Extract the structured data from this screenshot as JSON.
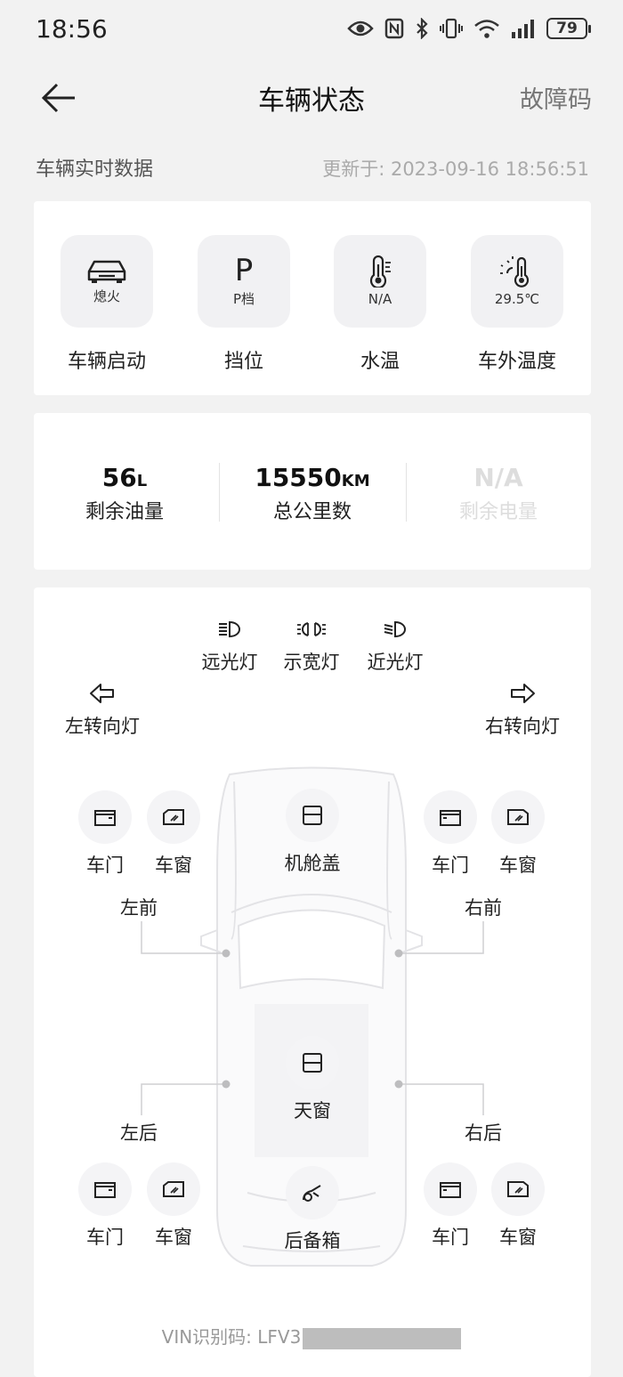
{
  "status_bar": {
    "time": "18:56",
    "battery": "79",
    "icons": [
      "eye-icon",
      "nfc-icon",
      "bluetooth-icon",
      "vibrate-icon",
      "wifi-icon",
      "signal-icon",
      "battery-icon"
    ]
  },
  "header": {
    "title": "车辆状态",
    "action": "故障码"
  },
  "realtime": {
    "label": "车辆实时数据",
    "updated": "更新于:  2023-09-16 18:56:51"
  },
  "status_tiles": [
    {
      "value": "熄火",
      "label": "车辆启动",
      "icon": "car-icon"
    },
    {
      "value": "P档",
      "label": "挡位",
      "icon": "gear-p-icon"
    },
    {
      "value": "N/A",
      "label": "水温",
      "icon": "thermometer-icon"
    },
    {
      "value": "29.5℃",
      "label": "车外温度",
      "icon": "sun-thermometer-icon"
    }
  ],
  "gear_glyph": "P",
  "metrics": [
    {
      "value": "56",
      "unit": "L",
      "label": "剩余油量"
    },
    {
      "value": "15550",
      "unit": "KM",
      "label": "总公里数"
    },
    {
      "value": "N/A",
      "unit": "",
      "label": "剩余电量"
    }
  ],
  "lights": {
    "high_beam": "远光灯",
    "position": "示宽灯",
    "low_beam": "近光灯",
    "left_turn": "左转向灯",
    "right_turn": "右转向灯"
  },
  "zones": {
    "front_left": "左前",
    "front_right": "右前",
    "rear_left": "左后",
    "rear_right": "右后"
  },
  "controls": {
    "door": "车门",
    "window": "车窗",
    "hood": "机舱盖",
    "sunroof": "天窗",
    "trunk": "后备箱"
  },
  "vin": {
    "label": "VIN识别码:  LFV3"
  }
}
